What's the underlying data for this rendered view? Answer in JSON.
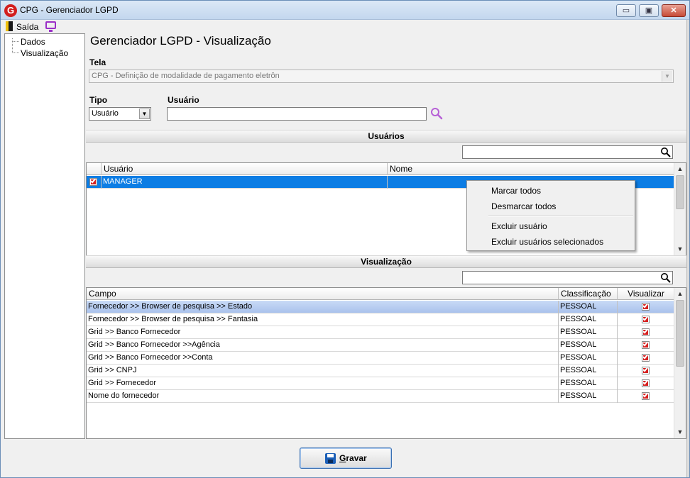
{
  "window": {
    "title": "CPG - Gerenciador LGPD",
    "app_icon_letter": "G",
    "min_glyph": "▭",
    "max_glyph": "▣",
    "close_glyph": "✕"
  },
  "menubar": {
    "exit_label": "Saída"
  },
  "tree": {
    "items": [
      {
        "label": "Dados"
      },
      {
        "label": "Visualização"
      }
    ]
  },
  "main": {
    "title": "Gerenciador LGPD - Visualização",
    "tela_label": "Tela",
    "tela_value": "CPG - Definição de modalidade de pagamento eletrôn",
    "tipo_label": "Tipo",
    "tipo_value": "Usuário",
    "usuario_label": "Usuário",
    "usuario_value": ""
  },
  "usuarios": {
    "section_title": "Usuários",
    "search_value": "",
    "columns": [
      "Usuário",
      "Nome"
    ],
    "rows": [
      {
        "checked": true,
        "usuario": "MANAGER",
        "nome": ""
      }
    ]
  },
  "context_menu": {
    "items": [
      "Marcar todos",
      "Desmarcar todos",
      "Excluir usuário",
      "Excluir usuários selecionados"
    ]
  },
  "visualizacao": {
    "section_title": "Visualização",
    "search_value": "",
    "columns": [
      "Campo",
      "Classificação",
      "Visualizar"
    ],
    "rows": [
      {
        "campo": "Fornecedor >> Browser de pesquisa >> Estado",
        "classificacao": "PESSOAL",
        "visualizar": true
      },
      {
        "campo": "Fornecedor >> Browser de pesquisa >> Fantasia",
        "classificacao": "PESSOAL",
        "visualizar": true
      },
      {
        "campo": "Grid >> Banco Fornecedor",
        "classificacao": "PESSOAL",
        "visualizar": true
      },
      {
        "campo": "Grid >> Banco Fornecedor >>Agência",
        "classificacao": "PESSOAL",
        "visualizar": true
      },
      {
        "campo": "Grid >> Banco Fornecedor >>Conta",
        "classificacao": "PESSOAL",
        "visualizar": true
      },
      {
        "campo": "Grid >> CNPJ",
        "classificacao": "PESSOAL",
        "visualizar": true
      },
      {
        "campo": "Grid >> Fornecedor",
        "classificacao": "PESSOAL",
        "visualizar": true
      },
      {
        "campo": "Nome do fornecedor",
        "classificacao": "PESSOAL",
        "visualizar": true
      }
    ]
  },
  "footer": {
    "save_first_letter": "G",
    "save_rest": "ravar"
  },
  "colors": {
    "selection_blue": "#0d7de4",
    "checkbox_red": "#d62020",
    "accent_purple": "#9b2fc7",
    "close_red": "#c74b37"
  }
}
